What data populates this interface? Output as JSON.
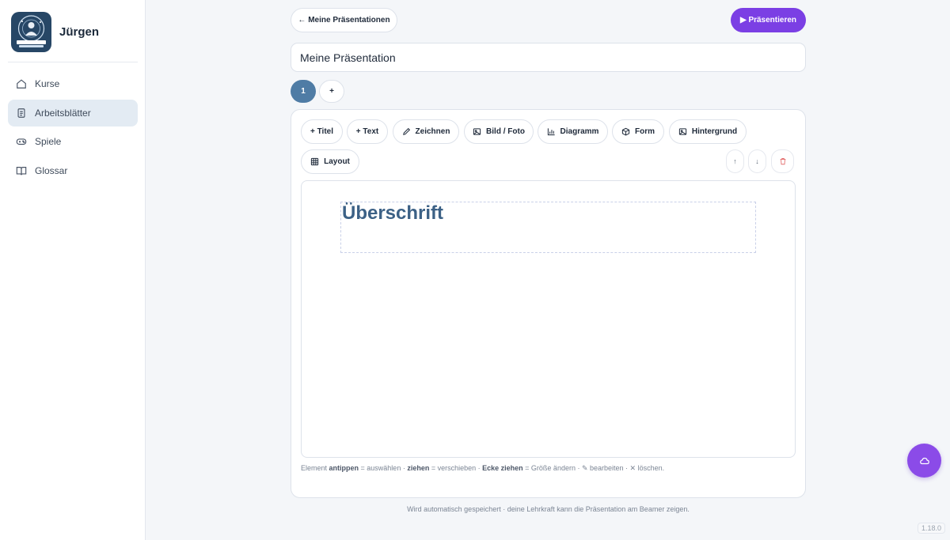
{
  "user": {
    "name": "Jürgen",
    "logo_text": "KOPERNIKUS LERNAPP"
  },
  "sidebar": {
    "items": [
      {
        "label": "Kurse",
        "icon": "home-icon",
        "active": false
      },
      {
        "label": "Arbeitsblätter",
        "icon": "document-icon",
        "active": true
      },
      {
        "label": "Spiele",
        "icon": "gamepad-icon",
        "active": false
      },
      {
        "label": "Glossar",
        "icon": "book-icon",
        "active": false
      }
    ]
  },
  "header": {
    "back_label": "← Meine Präsentationen",
    "present_label": "▶ Präsentieren",
    "presentation_title": "Meine Präsentation"
  },
  "slides": {
    "tabs": [
      "1"
    ],
    "add_label": "+"
  },
  "toolbar": {
    "items": [
      {
        "label": "+ Titel",
        "icon": ""
      },
      {
        "label": "+ Text",
        "icon": ""
      },
      {
        "label": "Zeichnen",
        "icon": "pencil-icon"
      },
      {
        "label": "Bild / Foto",
        "icon": "image-icon"
      },
      {
        "label": "Diagramm",
        "icon": "bar-chart-icon"
      },
      {
        "label": "Form",
        "icon": "cube-icon"
      },
      {
        "label": "Hintergrund",
        "icon": "image-icon"
      },
      {
        "label": "Layout",
        "icon": "grid-icon"
      }
    ],
    "move_up": "↑",
    "move_down": "↓",
    "delete": "trash-icon"
  },
  "canvas": {
    "title_text": "Überschrift"
  },
  "hint": {
    "p1": "Element ",
    "b1": "antippen",
    "p2": " = auswählen · ",
    "b2": "ziehen",
    "p3": " = verschieben · ",
    "b3": "Ecke ziehen",
    "p4": " = Größe ändern · ✎ bearbeiten · ✕ löschen."
  },
  "footer": {
    "autosave": "Wird automatisch gespeichert · deine Lehrkraft kann die Präsentation am Beamer zeigen.",
    "version": "1.18.0"
  },
  "colors": {
    "accent": "#7b3fe4",
    "slide_active": "#4f7ca5",
    "title": "#3c6186"
  }
}
